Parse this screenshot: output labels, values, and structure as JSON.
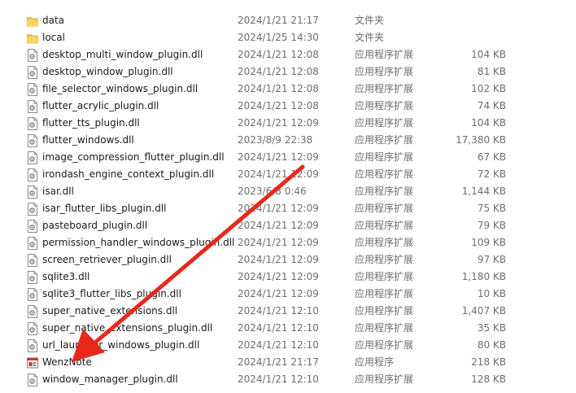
{
  "files": [
    {
      "name": "data",
      "date": "2024/1/21 21:17",
      "type": "文件夹",
      "size": "",
      "icon": "folder-icon"
    },
    {
      "name": "local",
      "date": "2024/1/25 14:30",
      "type": "文件夹",
      "size": "",
      "icon": "folder-icon"
    },
    {
      "name": "desktop_multi_window_plugin.dll",
      "date": "2024/1/21 12:08",
      "type": "应用程序扩展",
      "size": "104 KB",
      "icon": "dll-file-icon"
    },
    {
      "name": "desktop_window_plugin.dll",
      "date": "2024/1/21 12:08",
      "type": "应用程序扩展",
      "size": "81 KB",
      "icon": "dll-file-icon"
    },
    {
      "name": "file_selector_windows_plugin.dll",
      "date": "2024/1/21 12:08",
      "type": "应用程序扩展",
      "size": "102 KB",
      "icon": "dll-file-icon"
    },
    {
      "name": "flutter_acrylic_plugin.dll",
      "date": "2024/1/21 12:08",
      "type": "应用程序扩展",
      "size": "74 KB",
      "icon": "dll-file-icon"
    },
    {
      "name": "flutter_tts_plugin.dll",
      "date": "2024/1/21 12:09",
      "type": "应用程序扩展",
      "size": "104 KB",
      "icon": "dll-file-icon"
    },
    {
      "name": "flutter_windows.dll",
      "date": "2023/8/9 22:38",
      "type": "应用程序扩展",
      "size": "17,380 KB",
      "icon": "dll-file-icon"
    },
    {
      "name": "image_compression_flutter_plugin.dll",
      "date": "2024/1/21 12:09",
      "type": "应用程序扩展",
      "size": "67 KB",
      "icon": "dll-file-icon"
    },
    {
      "name": "irondash_engine_context_plugin.dll",
      "date": "2024/1/21 12:09",
      "type": "应用程序扩展",
      "size": "72 KB",
      "icon": "dll-file-icon"
    },
    {
      "name": "isar.dll",
      "date": "2023/6/8 0:46",
      "type": "应用程序扩展",
      "size": "1,144 KB",
      "icon": "dll-file-icon"
    },
    {
      "name": "isar_flutter_libs_plugin.dll",
      "date": "2024/1/21 12:09",
      "type": "应用程序扩展",
      "size": "75 KB",
      "icon": "dll-file-icon"
    },
    {
      "name": "pasteboard_plugin.dll",
      "date": "2024/1/21 12:09",
      "type": "应用程序扩展",
      "size": "79 KB",
      "icon": "dll-file-icon"
    },
    {
      "name": "permission_handler_windows_plugin.dll",
      "date": "2024/1/21 12:09",
      "type": "应用程序扩展",
      "size": "109 KB",
      "icon": "dll-file-icon"
    },
    {
      "name": "screen_retriever_plugin.dll",
      "date": "2024/1/21 12:09",
      "type": "应用程序扩展",
      "size": "97 KB",
      "icon": "dll-file-icon"
    },
    {
      "name": "sqlite3.dll",
      "date": "2024/1/21 12:09",
      "type": "应用程序扩展",
      "size": "1,180 KB",
      "icon": "dll-file-icon"
    },
    {
      "name": "sqlite3_flutter_libs_plugin.dll",
      "date": "2024/1/21 12:09",
      "type": "应用程序扩展",
      "size": "10 KB",
      "icon": "dll-file-icon"
    },
    {
      "name": "super_native_extensions.dll",
      "date": "2024/1/21 12:10",
      "type": "应用程序扩展",
      "size": "1,407 KB",
      "icon": "dll-file-icon"
    },
    {
      "name": "super_native_extensions_plugin.dll",
      "date": "2024/1/21 12:10",
      "type": "应用程序扩展",
      "size": "35 KB",
      "icon": "dll-file-icon"
    },
    {
      "name": "url_launcher_windows_plugin.dll",
      "date": "2024/1/21 12:10",
      "type": "应用程序扩展",
      "size": "80 KB",
      "icon": "dll-file-icon"
    },
    {
      "name": "WenzNote",
      "date": "2024/1/21 21:17",
      "type": "应用程序",
      "size": "218 KB",
      "icon": "app-exe-icon"
    },
    {
      "name": "window_manager_plugin.dll",
      "date": "2024/1/21 12:10",
      "type": "应用程序扩展",
      "size": "128 KB",
      "icon": "dll-file-icon"
    }
  ],
  "colors": {
    "arrow": "#e8281c",
    "folder": "#f4c542"
  }
}
